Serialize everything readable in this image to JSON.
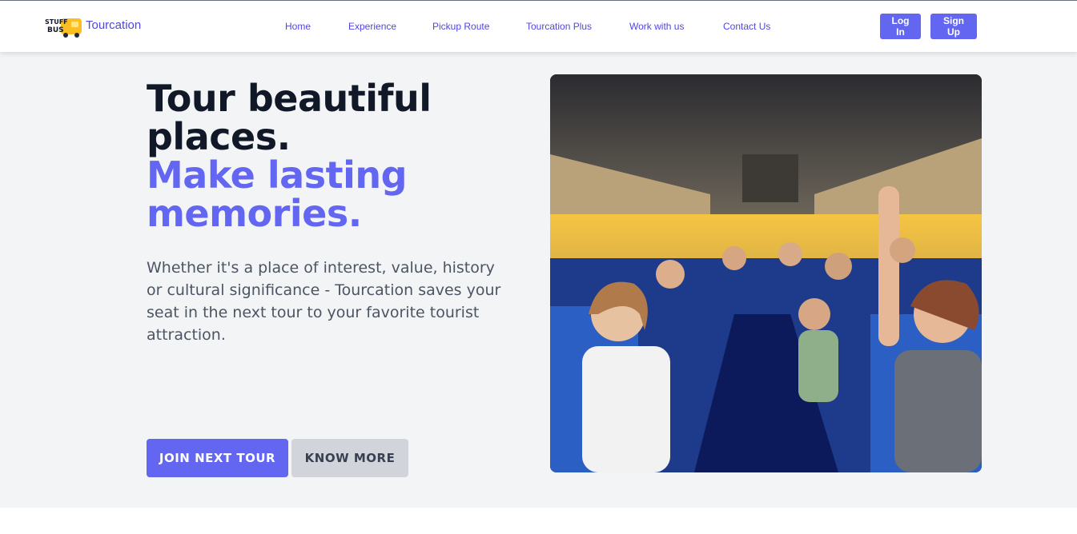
{
  "brand": {
    "logo_icon": "stuff-the-bus-logo",
    "name": "Tourcation"
  },
  "nav": [
    "Home",
    "Experience",
    "Pickup Route",
    "Tourcation Plus",
    "Work with us",
    "Contact Us"
  ],
  "auth": {
    "login": "Log In",
    "signup": "Sign Up"
  },
  "hero": {
    "title_line": "Tour beautiful places.",
    "title_accent": "Make lasting memories.",
    "description": "Whether it's a place of interest, value, history or cultural significance - Tourcation saves your seat in the next tour to your favorite tourist attraction.",
    "primary_button": "JOIN NEXT TOUR",
    "secondary_button": "KNOW MORE",
    "image": "photo of smiling tourists waving inside a tour bus"
  },
  "colors": {
    "accent": "#6366f1",
    "heading": "#111827",
    "body_bg": "#f3f4f6",
    "secondary_btn": "#d1d5db"
  }
}
